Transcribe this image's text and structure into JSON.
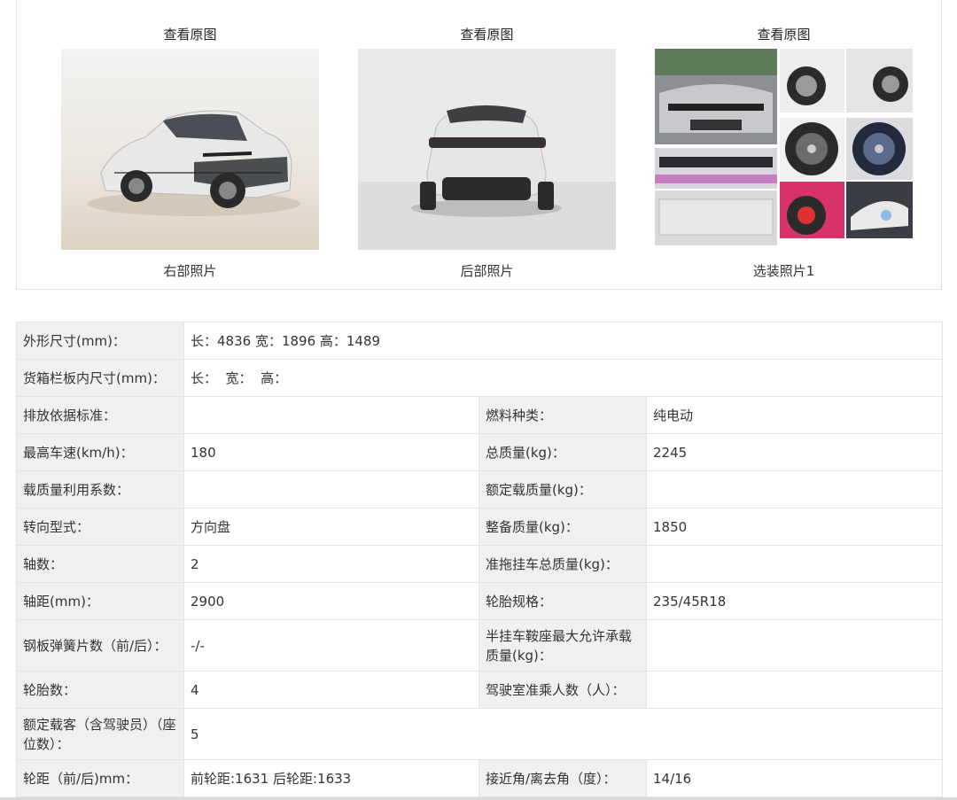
{
  "gallery": {
    "items": [
      {
        "link": "查看原图",
        "caption": "右部照片"
      },
      {
        "link": "查看原图",
        "caption": "后部照片"
      },
      {
        "link": "查看原图",
        "caption": "选装照片1"
      }
    ]
  },
  "specs": {
    "overall_size": {
      "label": "外形尺寸(mm)：",
      "value": "长：4836 宽：1896 高：1489"
    },
    "cargo_box_size": {
      "label": "货箱栏板内尺寸(mm)：",
      "value": "长：  宽：  高："
    },
    "emission_standard": {
      "label": "排放依据标准：",
      "value": ""
    },
    "fuel_type": {
      "label": "燃料种类：",
      "value": "纯电动"
    },
    "max_speed": {
      "label": "最高车速(km/h)：",
      "value": "180"
    },
    "gross_mass": {
      "label": "总质量(kg)：",
      "value": "2245"
    },
    "load_utilization": {
      "label": "载质量利用系数：",
      "value": ""
    },
    "rated_load": {
      "label": "额定载质量(kg)：",
      "value": ""
    },
    "steering": {
      "label": "转向型式：",
      "value": "方向盘"
    },
    "curb_mass": {
      "label": "整备质量(kg)：",
      "value": "1850"
    },
    "axle_count": {
      "label": "轴数：",
      "value": "2"
    },
    "trailer_mass": {
      "label": "准拖挂车总质量(kg)：",
      "value": ""
    },
    "wheelbase": {
      "label": "轴距(mm)：",
      "value": "2900"
    },
    "tire_spec": {
      "label": "轮胎规格：",
      "value": "235/45R18"
    },
    "leaf_springs": {
      "label": "钢板弹簧片数（前/后）：",
      "value": "-/-"
    },
    "saddle_load": {
      "label": "半挂车鞍座最大允许承载质量(kg)：",
      "value": ""
    },
    "tire_count": {
      "label": "轮胎数：",
      "value": "4"
    },
    "cab_passengers": {
      "label": "驾驶室准乘人数（人）：",
      "value": ""
    },
    "rated_passengers": {
      "label": "额定载客（含驾驶员）（座位数）：",
      "value": "5"
    },
    "track": {
      "label": "轮距（前/后)mm：",
      "value": "前轮距:1631 后轮距:1633"
    },
    "angles": {
      "label": "接近角/离去角（度）：",
      "value": "14/16"
    }
  }
}
